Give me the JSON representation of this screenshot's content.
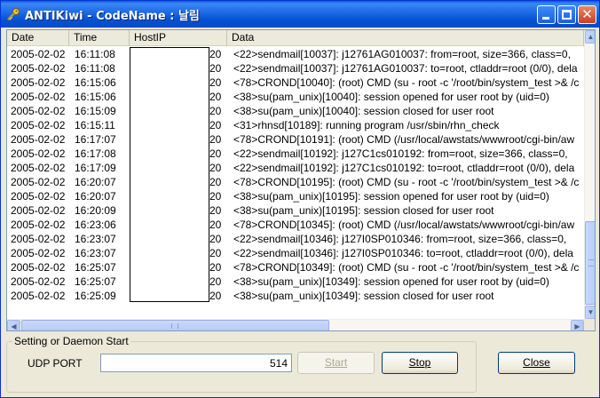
{
  "window": {
    "title": "ANTIKiwi - CodeName : 날림"
  },
  "listview": {
    "columns": [
      "Date",
      "Time",
      "HostIP",
      "Data"
    ],
    "rows": [
      {
        "date": "2005-02-02",
        "time": "16:11:08",
        "host": "20",
        "data": "<22>sendmail[10037]: j12761AG010037: from=root, size=366, class=0,"
      },
      {
        "date": "2005-02-02",
        "time": "16:11:08",
        "host": "20",
        "data": "<22>sendmail[10037]: j12761AG010037: to=root, ctladdr=root (0/0), dela"
      },
      {
        "date": "2005-02-02",
        "time": "16:15:06",
        "host": "20",
        "data": "<78>CROND[10040]: (root) CMD (su - root -c '/root/bin/system_test >& /c"
      },
      {
        "date": "2005-02-02",
        "time": "16:15:06",
        "host": "20",
        "data": "<38>su(pam_unix)[10040]: session opened for user root by (uid=0)"
      },
      {
        "date": "2005-02-02",
        "time": "16:15:09",
        "host": "20",
        "data": "<38>su(pam_unix)[10040]: session closed for user root"
      },
      {
        "date": "2005-02-02",
        "time": "16:15:11",
        "host": "20",
        "data": "<31>rhnsd[10189]: running program /usr/sbin/rhn_check"
      },
      {
        "date": "2005-02-02",
        "time": "16:17:07",
        "host": "20",
        "data": "<78>CROND[10191]: (root) CMD (/usr/local/awstats/wwwroot/cgi-bin/aw"
      },
      {
        "date": "2005-02-02",
        "time": "16:17:08",
        "host": "20",
        "data": "<22>sendmail[10192]: j127C1cs010192: from=root, size=366, class=0,"
      },
      {
        "date": "2005-02-02",
        "time": "16:17:09",
        "host": "20",
        "data": "<22>sendmail[10192]: j127C1cs010192: to=root, ctladdr=root (0/0), dela"
      },
      {
        "date": "2005-02-02",
        "time": "16:20:07",
        "host": "20",
        "data": "<78>CROND[10195]: (root) CMD (su - root -c '/root/bin/system_test >& /c"
      },
      {
        "date": "2005-02-02",
        "time": "16:20:07",
        "host": "20",
        "data": "<38>su(pam_unix)[10195]: session opened for user root by (uid=0)"
      },
      {
        "date": "2005-02-02",
        "time": "16:20:09",
        "host": "20",
        "data": "<38>su(pam_unix)[10195]: session closed for user root"
      },
      {
        "date": "2005-02-02",
        "time": "16:23:06",
        "host": "20",
        "data": "<78>CROND[10345]: (root) CMD (/usr/local/awstats/wwwroot/cgi-bin/aw"
      },
      {
        "date": "2005-02-02",
        "time": "16:23:07",
        "host": "20",
        "data": "<22>sendmail[10346]: j127I0SP010346: from=root, size=366, class=0,"
      },
      {
        "date": "2005-02-02",
        "time": "16:23:07",
        "host": "20",
        "data": "<22>sendmail[10346]: j127I0SP010346: to=root, ctladdr=root (0/0), dela"
      },
      {
        "date": "2005-02-02",
        "time": "16:25:07",
        "host": "20",
        "data": "<78>CROND[10349]: (root) CMD (su - root -c '/root/bin/system_test >& /c"
      },
      {
        "date": "2005-02-02",
        "time": "16:25:07",
        "host": "20",
        "data": "<38>su(pam_unix)[10349]: session opened for user root by (uid=0)"
      },
      {
        "date": "2005-02-02",
        "time": "16:25:09",
        "host": "20",
        "data": "<38>su(pam_unix)[10349]: session closed for user root"
      }
    ]
  },
  "settings": {
    "group_label": "Setting or Daemon Start",
    "udp_label": "UDP PORT",
    "udp_value": "514",
    "start_label": "Start",
    "stop_label": "Stop",
    "close_label": "Close"
  },
  "icons": {
    "app": "key-icon",
    "minimize": "minimize-icon",
    "maximize": "maximize-icon",
    "close": "close-icon"
  },
  "colors": {
    "titlebar": "#0553d4",
    "window_bg": "#ece9d8",
    "close_button": "#c8411d"
  }
}
